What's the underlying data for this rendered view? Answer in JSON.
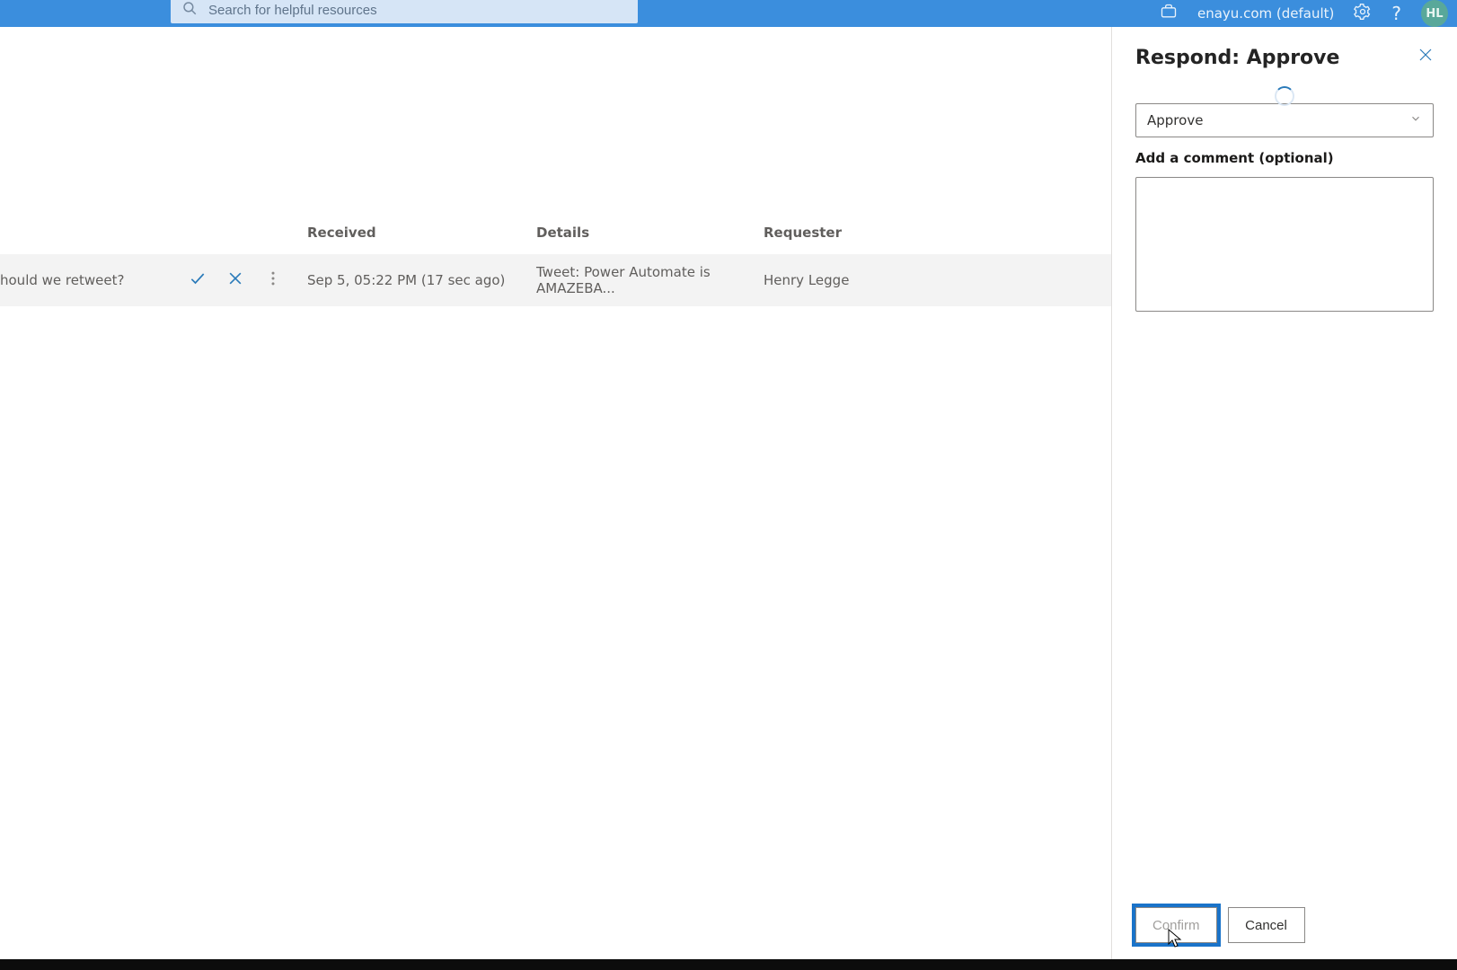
{
  "topbar": {
    "search_placeholder": "Search for helpful resources",
    "environment": "enayu.com (default)",
    "avatar_initials": "HL"
  },
  "columns": {
    "received": "Received",
    "details": "Details",
    "requester": "Requester"
  },
  "row": {
    "title_fragment": "hould we retweet?",
    "received": "Sep 5, 05:22 PM (17 sec ago)",
    "details": "Tweet: Power Automate is AMAZEBA...",
    "requester": "Henry Legge"
  },
  "panel": {
    "title": "Respond: Approve",
    "select_value": "Approve",
    "comment_label": "Add a comment (optional)",
    "comment_value": "",
    "confirm_label": "Confirm",
    "cancel_label": "Cancel"
  }
}
